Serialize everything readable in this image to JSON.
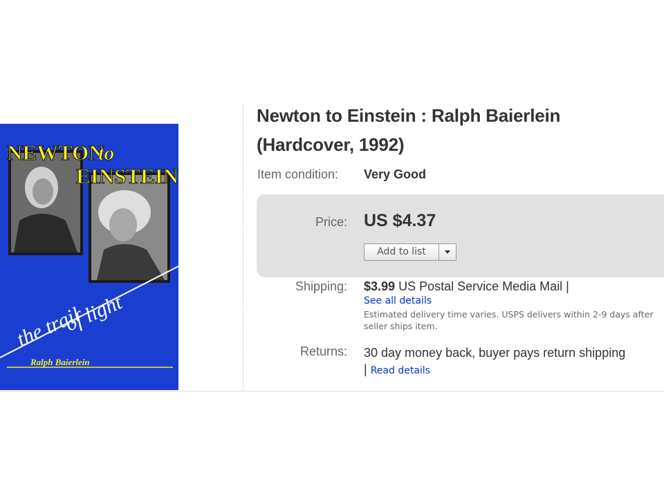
{
  "listing": {
    "title": "Newton to Einstein : Ralph Baierlein (Hardcover, 1992)",
    "condition_label": "Item condition:",
    "condition_value": "Very Good",
    "price_label": "Price:",
    "price_value": "US $4.37",
    "add_to_list_label": "Add to list",
    "shipping_label": "Shipping:",
    "shipping_cost": "$3.99",
    "shipping_method": "US Postal Service Media Mail",
    "shipping_separator": "|",
    "see_all_details": "See all details",
    "estimated_delivery": "Estimated delivery time varies. USPS delivers within 2-9 days after seller ships item.",
    "returns_label": "Returns:",
    "returns_text": "30 day money back, buyer pays return shipping |",
    "read_details": "Read details"
  },
  "cover": {
    "line1": "NEWTON",
    "line1b": "to",
    "line2": "EINSTEIN",
    "subtitle_1": "the trail",
    "subtitle_2": "of light",
    "author": "Ralph Baierlein",
    "background_color": "#1a3fd0",
    "title_color": "#f5ec2a"
  }
}
